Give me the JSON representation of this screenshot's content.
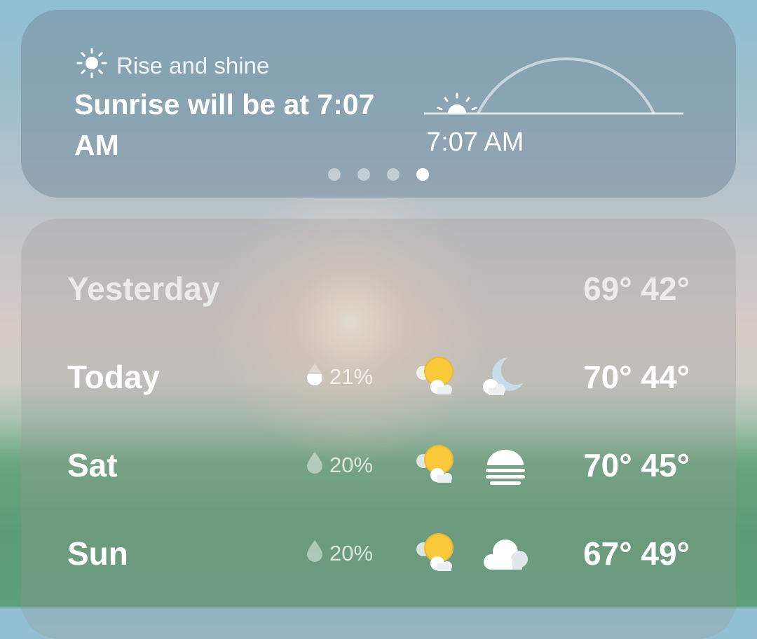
{
  "sunrise_card": {
    "eyebrow": "Rise and shine",
    "headline": "Sunrise will be at 7:07 AM",
    "time": "7:07 AM",
    "pager": {
      "count": 4,
      "active_index": 3
    }
  },
  "forecast": [
    {
      "day": "Yesterday",
      "high": "69°",
      "low": "42°",
      "temps": "69° 42°"
    },
    {
      "day": "Today",
      "precip": "21%",
      "day_icon": "partly-sunny-icon",
      "night_icon": "cloudy-moon-icon",
      "temps": "70° 44°"
    },
    {
      "day": "Sat",
      "precip": "20%",
      "day_icon": "partly-sunny-icon",
      "night_icon": "fog-icon",
      "temps": "70° 45°"
    },
    {
      "day": "Sun",
      "precip": "20%",
      "day_icon": "partly-sunny-icon",
      "night_icon": "cloud-icon",
      "temps": "67° 49°"
    }
  ],
  "colors": {
    "sun_yellow": "#f9c93a",
    "moon_blue": "#c8dcea"
  }
}
